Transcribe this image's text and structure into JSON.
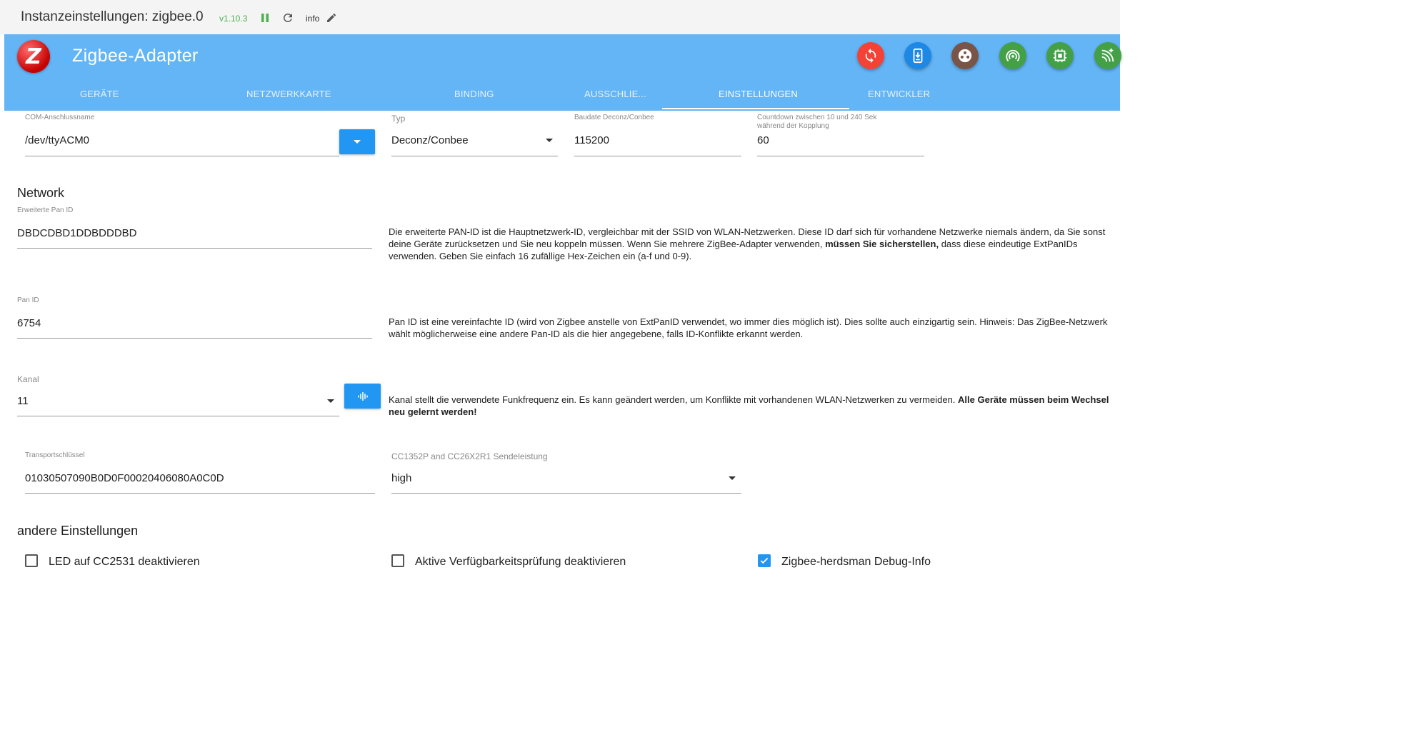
{
  "header": {
    "title": "Instanzeinstellungen: zigbee.0",
    "version": "v1.10.3",
    "loglevel": "info"
  },
  "app": {
    "title": "Zigbee-Adapter",
    "logo_letter": "Z",
    "actions": [
      {
        "icon": "refresh-icon",
        "color": "#f44336"
      },
      {
        "icon": "download-icon",
        "color": "#1e88e5"
      },
      {
        "icon": "hub-icon",
        "color": "#795548"
      },
      {
        "icon": "wifi-tethering-icon",
        "color": "#43a047"
      },
      {
        "icon": "chip-icon",
        "color": "#43a047"
      },
      {
        "icon": "signal-icon",
        "color": "#43a047"
      }
    ],
    "tabs": [
      "GERÄTE",
      "NETZWERKKARTE",
      "BINDING",
      "AUSSCHLIE...",
      "EINSTELLUNGEN",
      "ENTWICKLER"
    ],
    "active_tab": "EINSTELLUNGEN"
  },
  "port": {
    "com_label": "COM-Anschlussname",
    "com_value": "/dev/ttyACM0",
    "type_label": "Typ",
    "type_value": "Deconz/Conbee",
    "baud_label": "Baudate Deconz/Conbee",
    "baud_value": "115200",
    "countdown_label_1": "Countdown zwischen 10 und 240 Sek",
    "countdown_label_2": "während der Kopplung",
    "countdown_value": "60"
  },
  "network": {
    "heading": "Network",
    "ext_pan_label": "Erweiterte Pan ID",
    "ext_pan_value": "DBDCDBD1DDBDDDBD",
    "ext_pan_help_1": "Die erweiterte PAN-ID ist die Hauptnetzwerk-ID, vergleichbar mit der SSID von WLAN-Netzwerken. Diese ID darf sich für vorhandene Netzwerke niemals ändern, da Sie sonst deine Geräte zurücksetzen und Sie neu koppeln müssen. Wenn Sie mehrere ZigBee-Adapter verwenden, ",
    "ext_pan_help_bold": "müssen Sie sicherstellen,",
    "ext_pan_help_2": " dass diese eindeutige ExtPanIDs verwenden. Geben Sie einfach 16 zufällige Hex-Zeichen ein (a-f und 0-9).",
    "pan_label": "Pan ID",
    "pan_value": "6754",
    "pan_help": "Pan ID ist eine vereinfachte ID (wird von Zigbee anstelle von ExtPanID verwendet, wo immer dies möglich ist). Dies sollte auch einzigartig sein. Hinweis: Das ZigBee-Netzwerk wählt möglicherweise eine andere Pan-ID als die hier angegebene, falls ID-Konflikte erkannt werden.",
    "channel_label": "Kanal",
    "channel_value": "11",
    "channel_help_1": "Kanal stellt die verwendete Funkfrequenz ein. Es kann geändert werden, um Konflikte mit vorhandenen WLAN-Netzwerken zu vermeiden. ",
    "channel_help_bold": "Alle Geräte müssen beim Wechsel neu gelernt werden!",
    "transport_label": "Transportschlüssel",
    "transport_value": "01030507090B0D0F00020406080A0C0D",
    "power_label": "CC1352P and CC26X2R1 Sendeleistung",
    "power_value": "high"
  },
  "other": {
    "heading": "andere Einstellungen",
    "options": [
      {
        "label": "LED auf CC2531 deaktivieren",
        "checked": false
      },
      {
        "label": "Aktive Verfügbarkeitsprüfung deaktivieren",
        "checked": false
      },
      {
        "label": "Zigbee-herdsman Debug-Info",
        "checked": true
      }
    ]
  }
}
